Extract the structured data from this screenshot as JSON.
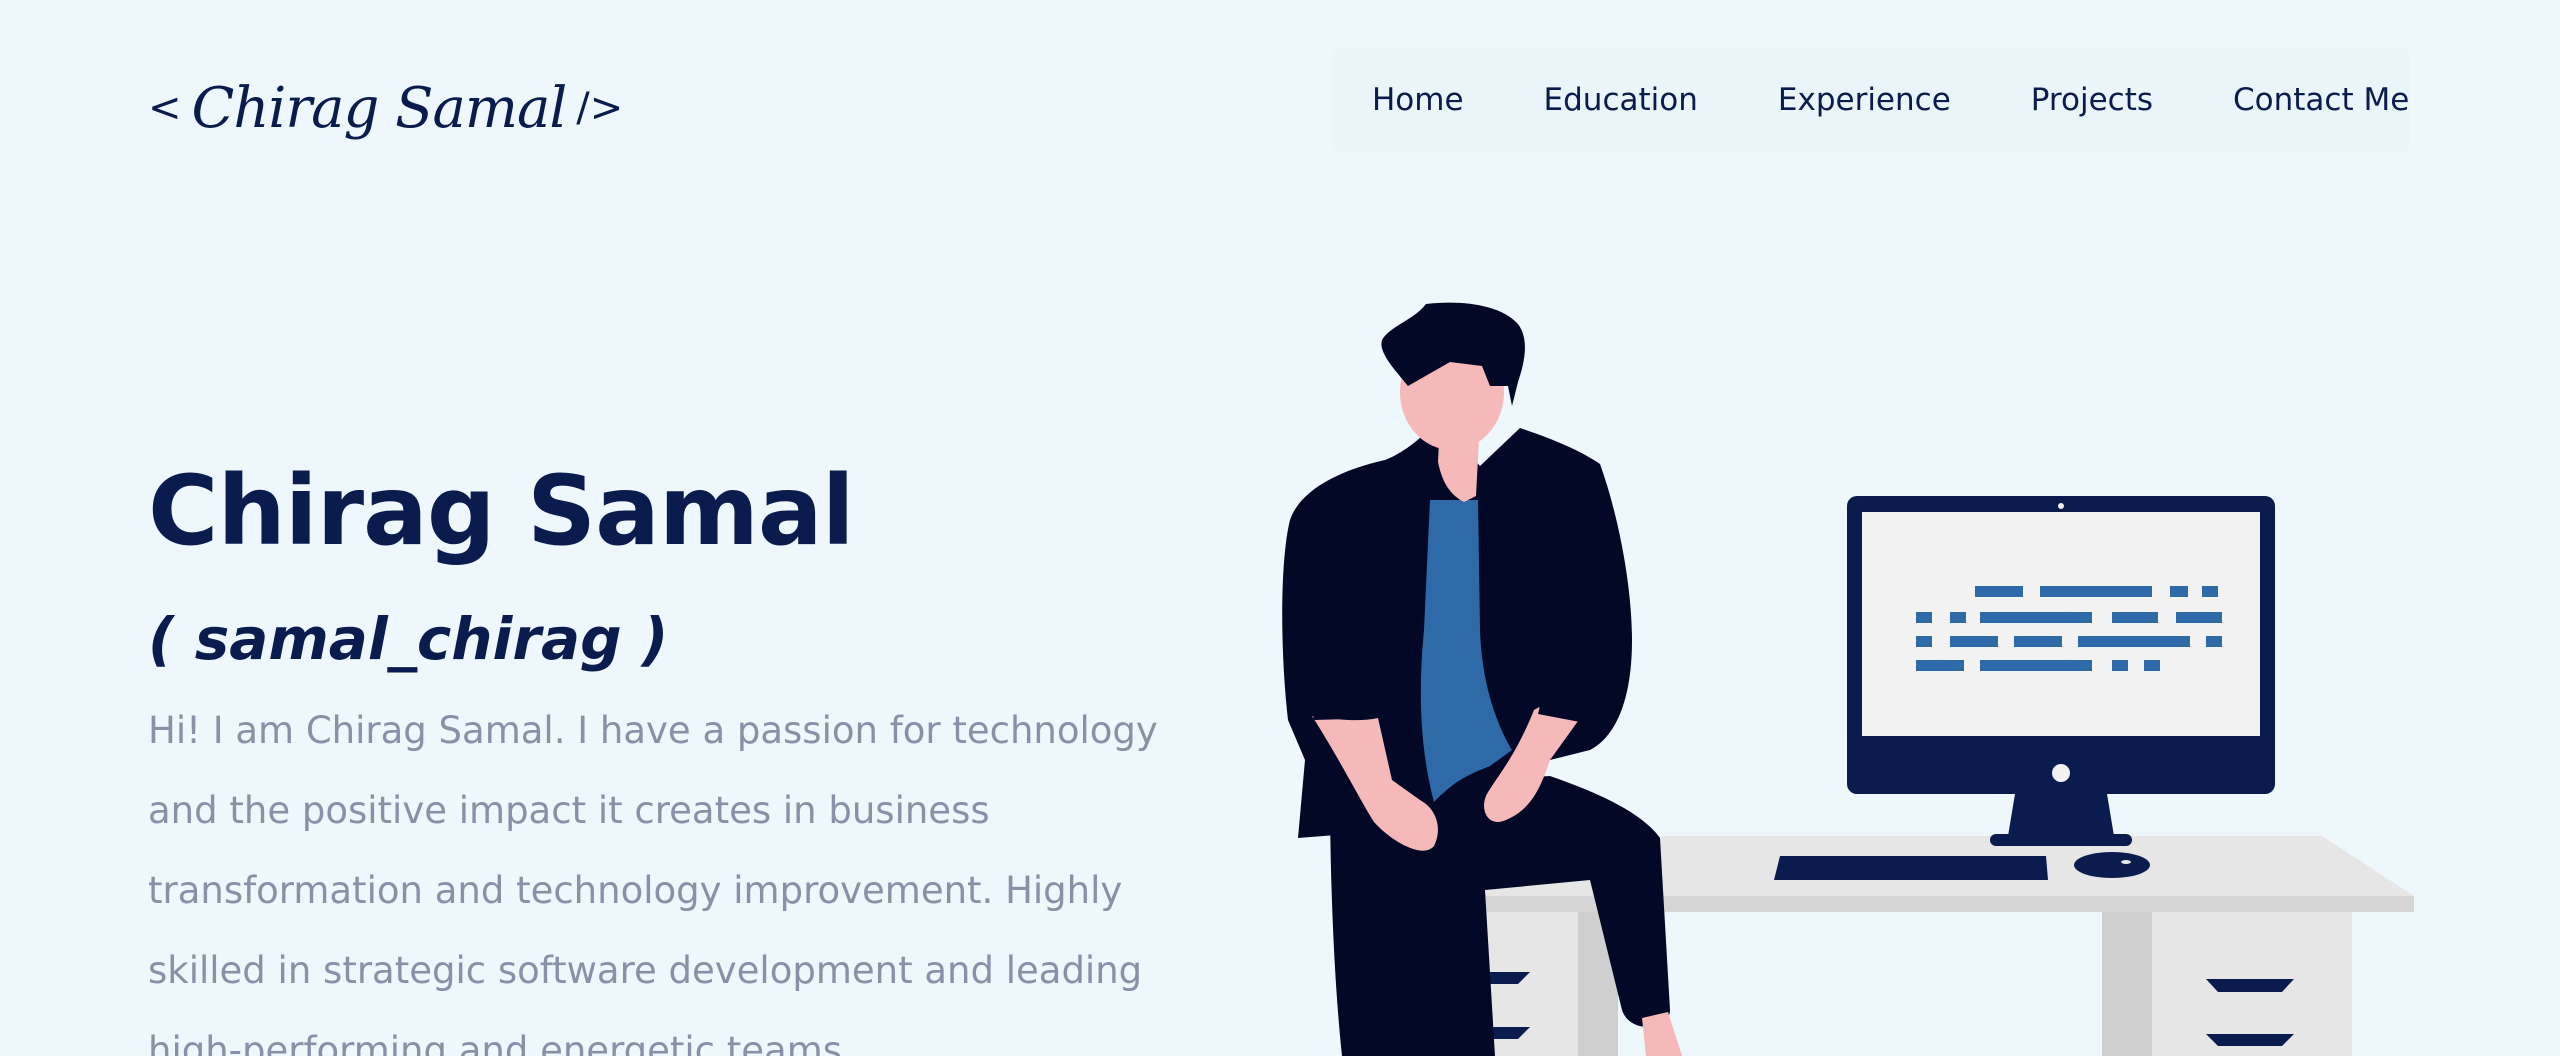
{
  "header": {
    "logo": {
      "open": "<",
      "signature": "Chirag Samal",
      "close": "/>"
    },
    "nav": [
      {
        "label": "Home"
      },
      {
        "label": "Education"
      },
      {
        "label": "Experience"
      },
      {
        "label": "Projects"
      },
      {
        "label": "Contact Me"
      }
    ]
  },
  "hero": {
    "name": "Chirag Samal",
    "handle": "( samal_chirag )",
    "bio": "Hi! I am Chirag Samal. I have a passion for technology and the positive impact it creates in business transformation and technology improvement. Highly skilled in strategic software development and leading high-performing and energetic teams."
  },
  "colors": {
    "background": "#edf7fc",
    "primary": "#0a1b4d",
    "text_muted": "#8892a6",
    "accent_blue": "#2f6aa8",
    "skin": "#f4b9b8",
    "dark": "#020826",
    "desk": "#e6e6e6"
  },
  "illustration": {
    "icon": "developer-at-desk-illustration"
  }
}
